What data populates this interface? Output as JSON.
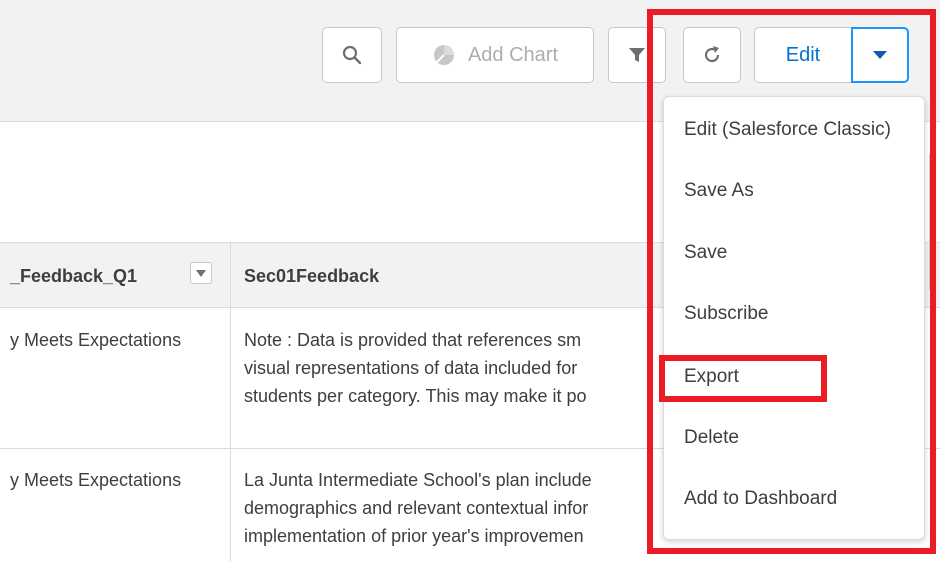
{
  "toolbar": {
    "search_icon": "search-icon",
    "add_chart_label": "Add Chart",
    "add_chart_icon": "chart-icon",
    "filter_icon": "filter-icon",
    "refresh_icon": "refresh-icon",
    "edit_label": "Edit",
    "caret_icon": "caret-down-icon"
  },
  "table": {
    "columns": [
      "_Feedback_Q1",
      "Sec01Feedback"
    ],
    "rows": [
      {
        "col1": "y Meets Expectations",
        "col2": [
          "Note : Data is provided that references sm",
          "visual representations of data included for",
          "students per category. This may make it po"
        ]
      },
      {
        "col1": "y Meets Expectations",
        "col2": [
          "La Junta Intermediate School's plan include",
          "demographics and relevant contextual infor",
          "implementation of prior year's improvemen"
        ]
      }
    ]
  },
  "menu": {
    "items": [
      "Edit (Salesforce Classic)",
      "Save As",
      "Save",
      "Subscribe",
      "Export",
      "Delete",
      "Add to Dashboard"
    ]
  },
  "colors": {
    "highlight": "#ec1c24",
    "accent": "#0070d2",
    "caret_border": "#1b96ff"
  }
}
